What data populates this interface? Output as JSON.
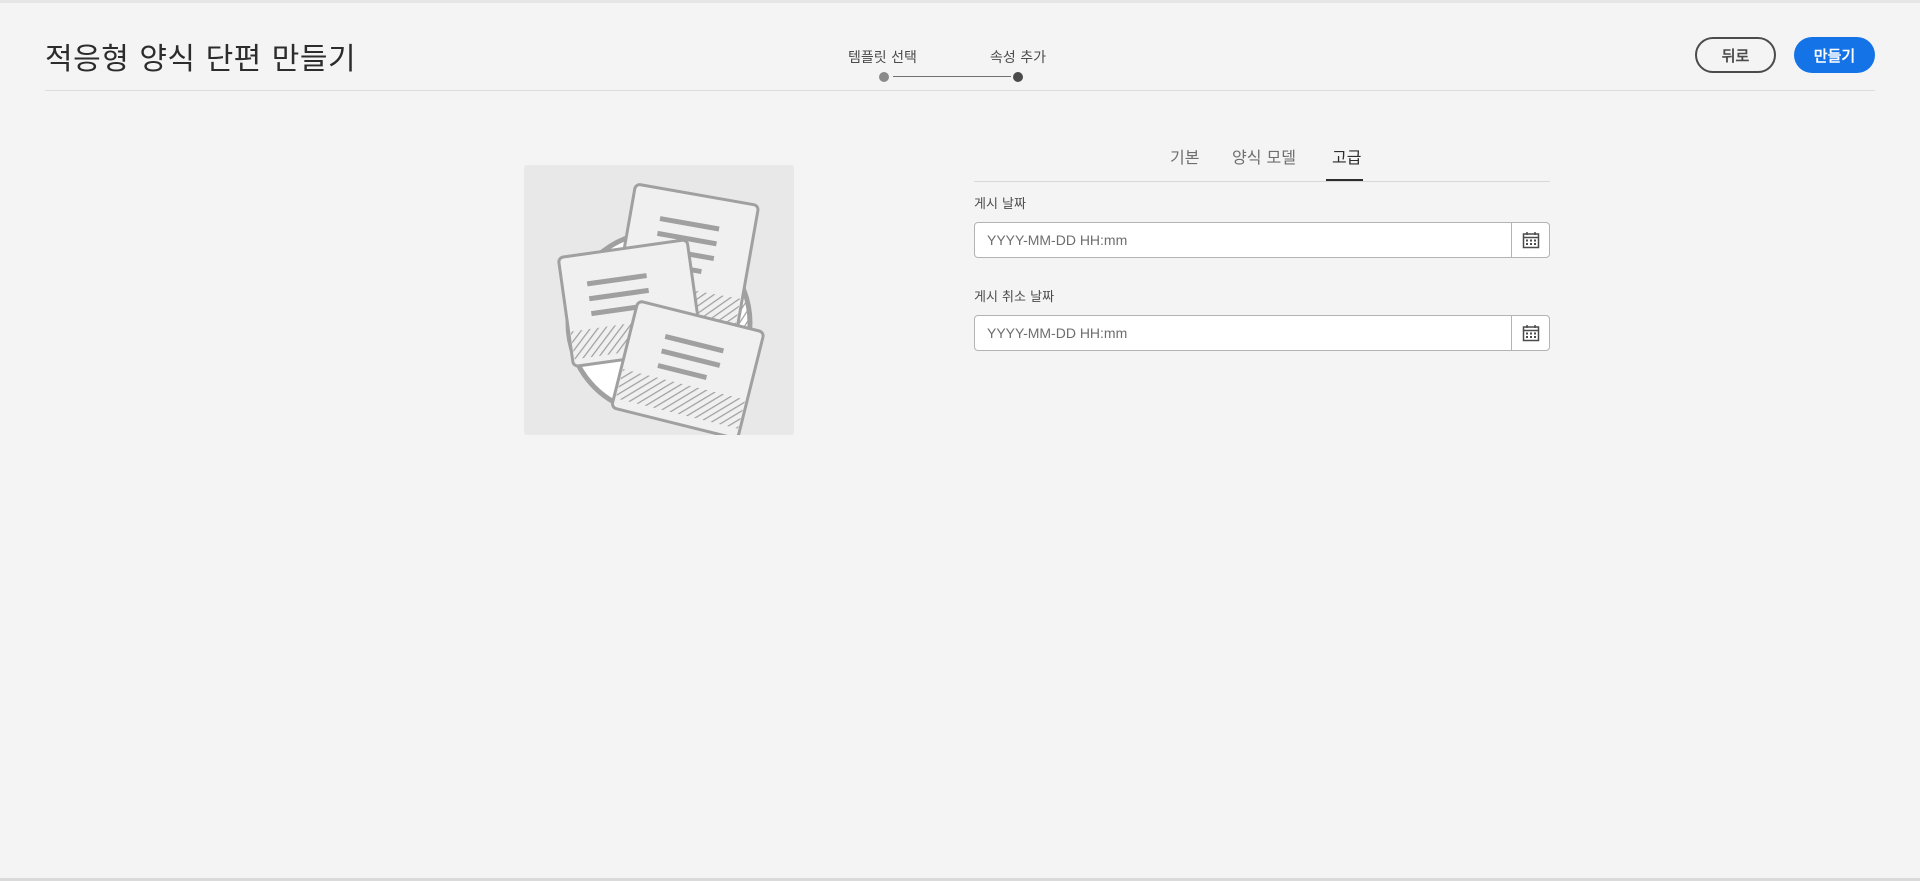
{
  "header": {
    "title": "적응형 양식 단편 만들기",
    "back_label": "뒤로",
    "create_label": "만들기"
  },
  "wizard": {
    "steps": [
      {
        "label": "템플릿 선택",
        "status": "completed"
      },
      {
        "label": "속성 추가",
        "status": "current"
      }
    ]
  },
  "tabs": [
    {
      "label": "기본",
      "active": false
    },
    {
      "label": "양식 모델",
      "active": false
    },
    {
      "label": "고급",
      "active": true
    }
  ],
  "form": {
    "publish_date": {
      "label": "게시 날짜",
      "placeholder": "YYYY-MM-DD HH:mm",
      "value": ""
    },
    "unpublish_date": {
      "label": "게시 취소 날짜",
      "placeholder": "YYYY-MM-DD HH:mm",
      "value": ""
    }
  },
  "icons": {
    "preview": "fragment-documents-illustration",
    "calendar": "calendar-icon"
  },
  "colors": {
    "background": "#f4f4f4",
    "primary_button": "#1473e6",
    "text": "#2c2c2c"
  }
}
